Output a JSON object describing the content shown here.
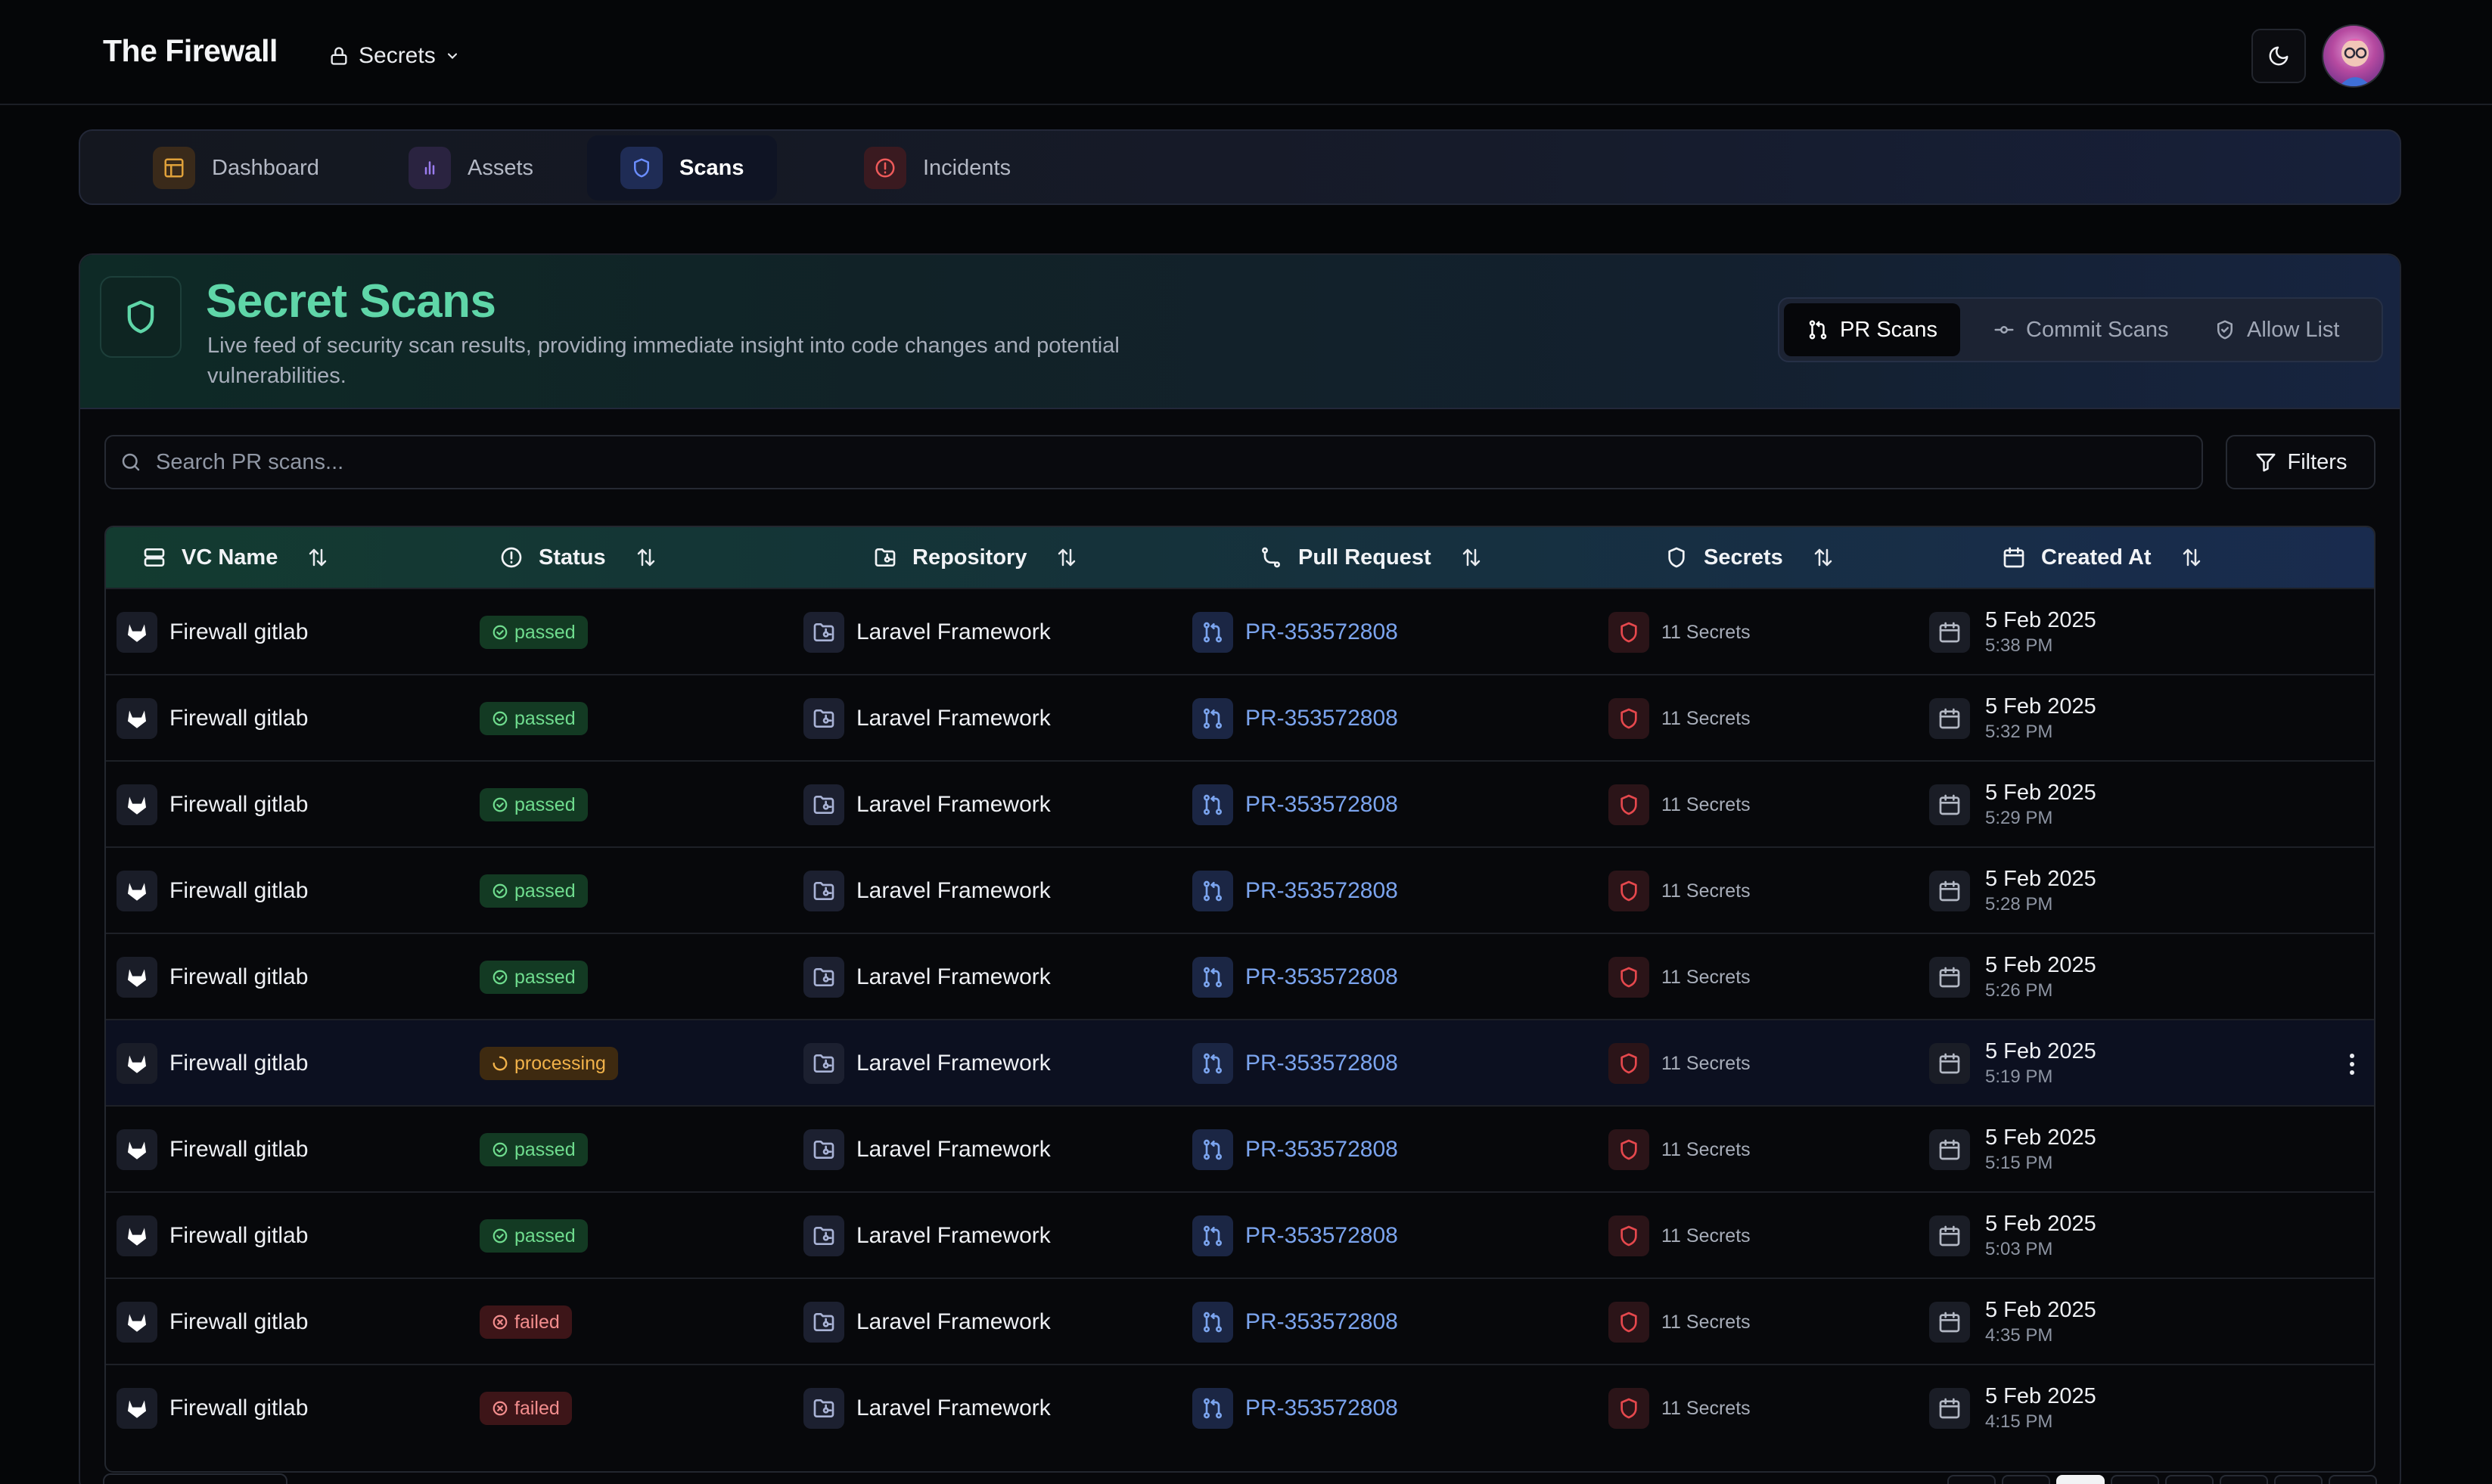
{
  "header": {
    "brand": "The Firewall",
    "workspace_label": "Secrets"
  },
  "nav": {
    "items": [
      {
        "label": "Dashboard",
        "icon": "layout-icon",
        "color": "#e0a13a",
        "active": false
      },
      {
        "label": "Assets",
        "icon": "bar-chart-icon",
        "color": "#9b7df0",
        "active": false
      },
      {
        "label": "Scans",
        "icon": "shield-icon",
        "color": "#6a8dff",
        "active": true
      },
      {
        "label": "Incidents",
        "icon": "alert-circle-icon",
        "color": "#ef5a5a",
        "active": false
      }
    ]
  },
  "page": {
    "title": "Secret Scans",
    "description": "Live feed of security scan results, providing immediate insight into code changes and potential vulnerabilities."
  },
  "scan_tabs": [
    {
      "label": "PR Scans",
      "icon": "git-pull-request-icon",
      "active": true
    },
    {
      "label": "Commit Scans",
      "icon": "git-commit-icon",
      "active": false
    },
    {
      "label": "Allow List",
      "icon": "shield-check-icon",
      "active": false
    }
  ],
  "search": {
    "placeholder": "Search PR scans..."
  },
  "filters_label": "Filters",
  "table": {
    "columns": [
      {
        "label": "VC Name",
        "icon": "server-icon"
      },
      {
        "label": "Status",
        "icon": "alert-circle-icon"
      },
      {
        "label": "Repository",
        "icon": "folder-git-icon"
      },
      {
        "label": "Pull Request",
        "icon": "git-branch-icon"
      },
      {
        "label": "Secrets",
        "icon": "shield-icon"
      },
      {
        "label": "Created At",
        "icon": "calendar-icon"
      }
    ],
    "rows": [
      {
        "vc": "Firewall gitlab",
        "status": "passed",
        "repo": "Laravel Framework",
        "pr": "PR-353572808",
        "secrets": "11 Secrets",
        "date": "5 Feb 2025",
        "time": "5:38 PM"
      },
      {
        "vc": "Firewall gitlab",
        "status": "passed",
        "repo": "Laravel Framework",
        "pr": "PR-353572808",
        "secrets": "11 Secrets",
        "date": "5 Feb 2025",
        "time": "5:32 PM"
      },
      {
        "vc": "Firewall gitlab",
        "status": "passed",
        "repo": "Laravel Framework",
        "pr": "PR-353572808",
        "secrets": "11 Secrets",
        "date": "5 Feb 2025",
        "time": "5:29 PM"
      },
      {
        "vc": "Firewall gitlab",
        "status": "passed",
        "repo": "Laravel Framework",
        "pr": "PR-353572808",
        "secrets": "11 Secrets",
        "date": "5 Feb 2025",
        "time": "5:28 PM"
      },
      {
        "vc": "Firewall gitlab",
        "status": "passed",
        "repo": "Laravel Framework",
        "pr": "PR-353572808",
        "secrets": "11 Secrets",
        "date": "5 Feb 2025",
        "time": "5:26 PM"
      },
      {
        "vc": "Firewall gitlab",
        "status": "processing",
        "repo": "Laravel Framework",
        "pr": "PR-353572808",
        "secrets": "11 Secrets",
        "date": "5 Feb 2025",
        "time": "5:19 PM"
      },
      {
        "vc": "Firewall gitlab",
        "status": "passed",
        "repo": "Laravel Framework",
        "pr": "PR-353572808",
        "secrets": "11 Secrets",
        "date": "5 Feb 2025",
        "time": "5:15 PM"
      },
      {
        "vc": "Firewall gitlab",
        "status": "passed",
        "repo": "Laravel Framework",
        "pr": "PR-353572808",
        "secrets": "11 Secrets",
        "date": "5 Feb 2025",
        "time": "5:03 PM"
      },
      {
        "vc": "Firewall gitlab",
        "status": "failed",
        "repo": "Laravel Framework",
        "pr": "PR-353572808",
        "secrets": "11 Secrets",
        "date": "5 Feb 2025",
        "time": "4:35 PM"
      },
      {
        "vc": "Firewall gitlab",
        "status": "failed",
        "repo": "Laravel Framework",
        "pr": "PR-353572808",
        "secrets": "11 Secrets",
        "date": "5 Feb 2025",
        "time": "4:15 PM"
      }
    ]
  },
  "colors": {
    "accent_green": "#5fd6a8",
    "link_blue": "#7ba4ee",
    "passed": "#6fdc8e",
    "processing": "#f1b24a",
    "failed": "#f28d8d"
  }
}
